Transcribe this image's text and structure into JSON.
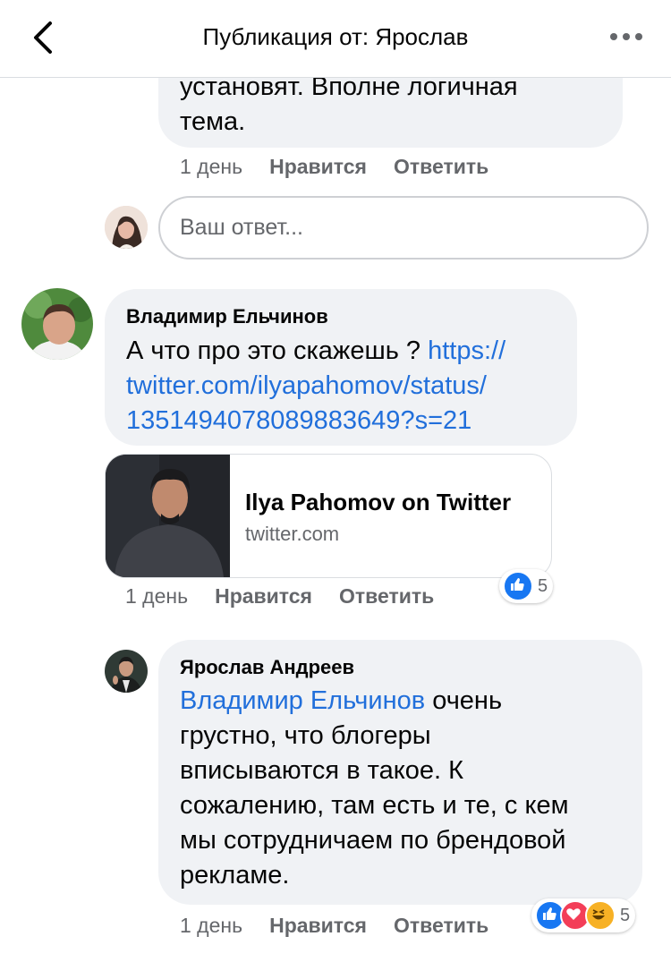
{
  "header": {
    "title": "Публикация от: Ярослав"
  },
  "comment1": {
    "text_tail": [
      "установят. Вполне логичная",
      "тема."
    ],
    "time": "1 день",
    "like": "Нравится",
    "reply": "Ответить"
  },
  "reply_box": {
    "placeholder": "Ваш ответ..."
  },
  "comment2": {
    "author": "Владимир Ельчинов",
    "text_prefix": "А что про это скажешь ?",
    "link_lines": [
      "https://",
      "twitter.com/ilyapahomov/status/",
      "1351494078089883649?s=21"
    ],
    "preview": {
      "title": "Ilya Pahomov on Twitter",
      "domain": "twitter.com"
    },
    "time": "1 день",
    "like": "Нравится",
    "reply": "Ответить",
    "reactions": {
      "icons": [
        "like-icon"
      ],
      "count": "5"
    }
  },
  "comment3": {
    "author": "Ярослав Андреев",
    "mention": "Владимир Ельчинов",
    "text_after_mention": "очень",
    "lines": [
      "грустно, что блогеры",
      "вписываются в такое. К",
      "сожалению, там есть и те, с кем",
      "мы сотрудничаем по брендовой",
      "рекламе."
    ],
    "time": "1 день",
    "like": "Нравится",
    "reply": "Ответить",
    "reactions": {
      "icons": [
        "like-icon",
        "love-icon",
        "haha-icon"
      ],
      "count": "5"
    }
  },
  "colors": {
    "link": "#216fdb",
    "bubble": "#f0f2f5",
    "meta": "#65676b",
    "like": "#1877f2",
    "love": "#f33e58",
    "haha": "#f7b125"
  }
}
